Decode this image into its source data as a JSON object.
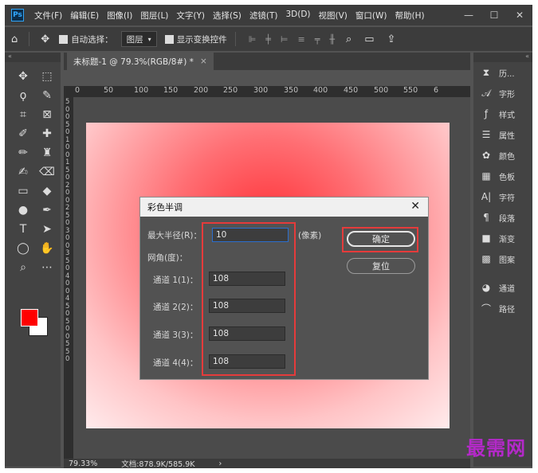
{
  "app": {
    "logo": "Ps",
    "menu": [
      "文件(F)",
      "编辑(E)",
      "图像(I)",
      "图层(L)",
      "文字(Y)",
      "选择(S)",
      "滤镜(T)",
      "3D(D)",
      "视图(V)",
      "窗口(W)",
      "帮助(H)"
    ],
    "window_controls": [
      "—",
      "☐",
      "✕"
    ]
  },
  "options_bar": {
    "auto_select_label": "自动选择：",
    "layer_select": "图层",
    "show_transform_label": "显示变换控件"
  },
  "document": {
    "tab_title": "未标题-1 @ 79.3%(RGB/8#) *",
    "ruler_h": [
      "0",
      "50",
      "100",
      "150",
      "200",
      "250",
      "300",
      "350",
      "400",
      "450",
      "500",
      "550",
      "6"
    ],
    "ruler_v": [
      "5",
      "0",
      "0",
      "5",
      "0",
      "1",
      "0",
      "0",
      "1",
      "5",
      "0",
      "2",
      "0",
      "0",
      "2",
      "5",
      "0",
      "3",
      "0",
      "0",
      "3",
      "5",
      "0",
      "4",
      "0",
      "0",
      "4",
      "5",
      "0",
      "5",
      "0",
      "0",
      "5",
      "5",
      "0"
    ],
    "zoom": "79.33%",
    "doc_info": "文档:878.9K/585.9K"
  },
  "right_panel": {
    "items": [
      {
        "icon": "history-icon",
        "label": "历..."
      },
      {
        "icon": "glyphs-icon",
        "label": "字形"
      },
      {
        "icon": "styles-icon",
        "label": "样式"
      },
      {
        "icon": "properties-icon",
        "label": "属性"
      },
      {
        "icon": "color-icon",
        "label": "颜色"
      },
      {
        "icon": "swatches-icon",
        "label": "色板"
      },
      {
        "icon": "character-icon",
        "label": "字符"
      },
      {
        "icon": "paragraph-icon",
        "label": "段落"
      },
      {
        "icon": "gradient-icon",
        "label": "渐变"
      },
      {
        "icon": "patterns-icon",
        "label": "图案"
      },
      {
        "icon": "channels-icon",
        "label": "通道"
      },
      {
        "icon": "paths-icon",
        "label": "路径"
      }
    ]
  },
  "colors": {
    "foreground": "#ff0000",
    "background": "#ffffff"
  },
  "dialog": {
    "title": "彩色半调",
    "max_radius_label": "最大半径(R)：",
    "max_radius_value": "10",
    "unit_label": "(像素)",
    "angle_label": "网角(度)：",
    "channels": [
      {
        "label": "通道 1(1)：",
        "value": "108"
      },
      {
        "label": "通道 2(2)：",
        "value": "108"
      },
      {
        "label": "通道 3(3)：",
        "value": "108"
      },
      {
        "label": "通道 4(4)：",
        "value": "108"
      }
    ],
    "ok_label": "确定",
    "reset_label": "复位",
    "close_label": "✕"
  },
  "watermark": "最需网"
}
